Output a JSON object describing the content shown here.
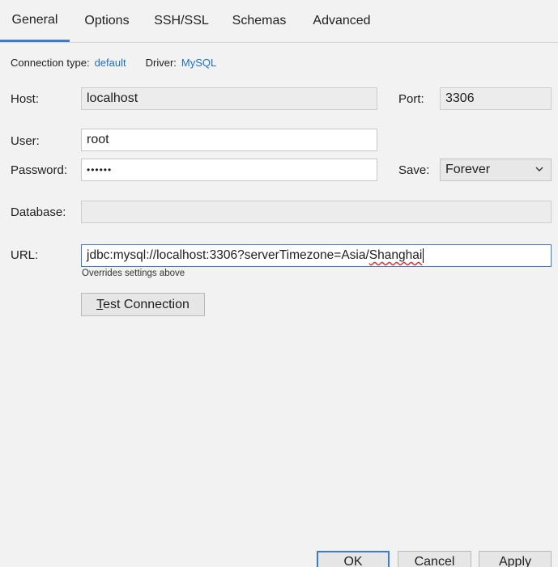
{
  "tabs": [
    {
      "label": "General",
      "active": true
    },
    {
      "label": "Options"
    },
    {
      "label": "SSH/SSL"
    },
    {
      "label": "Schemas"
    },
    {
      "label": "Advanced"
    }
  ],
  "meta": {
    "connection_type_label": "Connection type:",
    "connection_type_value": "default",
    "driver_label": "Driver:",
    "driver_value": "MySQL"
  },
  "form": {
    "host_label": "Host:",
    "host_value": "localhost",
    "port_label": "Port:",
    "port_value": "3306",
    "user_label": "User:",
    "user_value": "root",
    "password_label": "Password:",
    "password_value": "••••••",
    "save_label": "Save:",
    "save_value": "Forever",
    "database_label": "Database:",
    "database_value": "",
    "url_label": "URL:",
    "url_value_prefix": "jdbc:mysql://localhost:3306?serverTimezone=Asia/",
    "url_value_misspelled": "Shanghai",
    "url_hint": "Overrides settings above"
  },
  "buttons": {
    "test_connection_mnemonic": "T",
    "test_connection_rest": "est Connection",
    "ok": "OK",
    "cancel": "Cancel",
    "apply": "Apply"
  },
  "colors": {
    "accent": "#3b7bd4",
    "link": "#1c6fc9",
    "background": "#f2f2f2"
  }
}
